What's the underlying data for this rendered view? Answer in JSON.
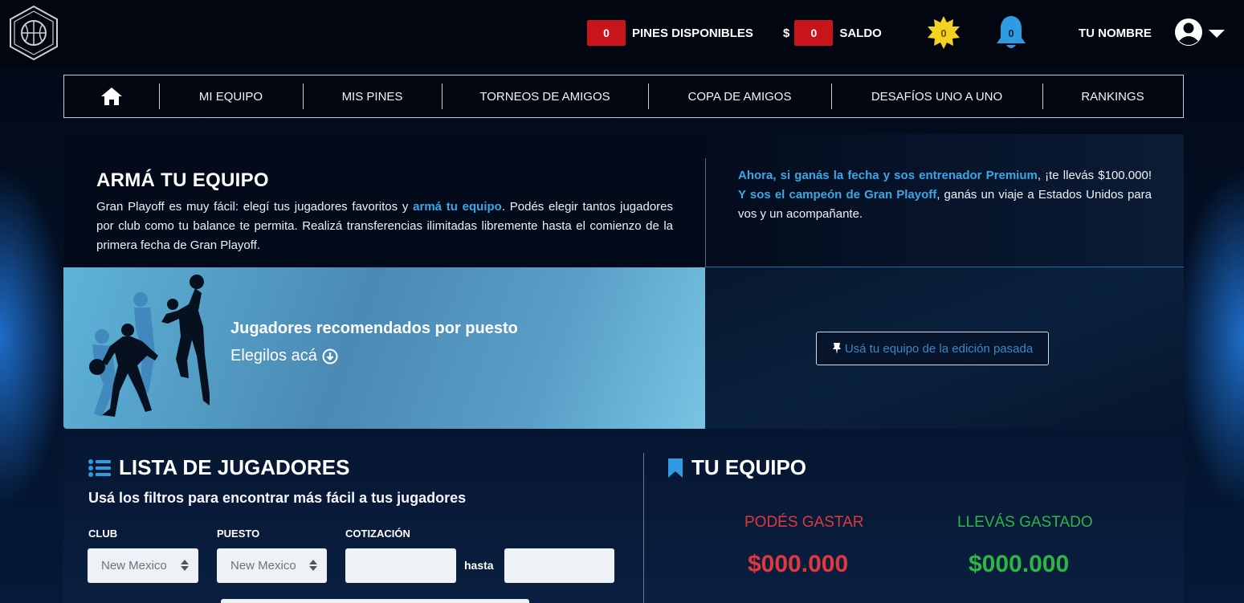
{
  "header": {
    "pins_count": "0",
    "pins_label": "PINES DISPONIBLES",
    "currency_symbol": "$",
    "balance": "0",
    "balance_label": "SALDO",
    "coins_count": "0",
    "notifications_count": "0",
    "username": "TU NOMBRE"
  },
  "nav": {
    "items": [
      "MI EQUIPO",
      "MIS PINES",
      "TORNEOS DE AMIGOS",
      "COPA DE AMIGOS",
      "DESAFÍOS UNO A UNO",
      "RANKINGS"
    ]
  },
  "hero": {
    "title": "ARMÁ TU EQUIPO",
    "text_before": "Gran Playoff es muy fácil: elegí tus jugadores favoritos y ",
    "text_link": "armá tu equipo",
    "text_after": ". Podés elegir tantos jugadores por club como tu balance te permita. Realizá transferencias ilimitadas libremente hasta el comienzo de la primera fecha de Gran Playoff.",
    "promo_hl1": "Ahora, si ganás la fecha y sos entrenador Premium",
    "promo_t1": ", ¡te llevás $100.000! ",
    "promo_hl2": "Y sos el campeón de Gran Playoff",
    "promo_t2": ", ganás un viaje a Estados Unidos para vos y un acompañante.",
    "rec_title": "Jugadores recomendados por puesto",
    "rec_sub": "Elegilos acá",
    "prev_button": "Usá tu equipo de la edición pasada"
  },
  "players": {
    "title": "LISTA DE JUGADORES",
    "subtitle": "Usá los filtros para encontrar más fácil a tus jugadores",
    "club_label": "CLUB",
    "club_value": "New Mexico",
    "position_label": "PUESTO",
    "position_value": "New Mexico",
    "price_label": "COTIZACIÓN",
    "to_label": "hasta"
  },
  "team": {
    "title": "TU EQUIPO",
    "can_spend_label": "PODÉS GASTAR",
    "can_spend_value": "$000.000",
    "spent_label": "LLEVÁS GASTADO",
    "spent_value": "$000.000"
  },
  "colors": {
    "accent_blue": "#3ba7e8",
    "alert_red": "#e0383e",
    "success_green": "#2fb545",
    "coin_yellow": "#f4d21f",
    "bell_blue": "#2f9be0"
  }
}
